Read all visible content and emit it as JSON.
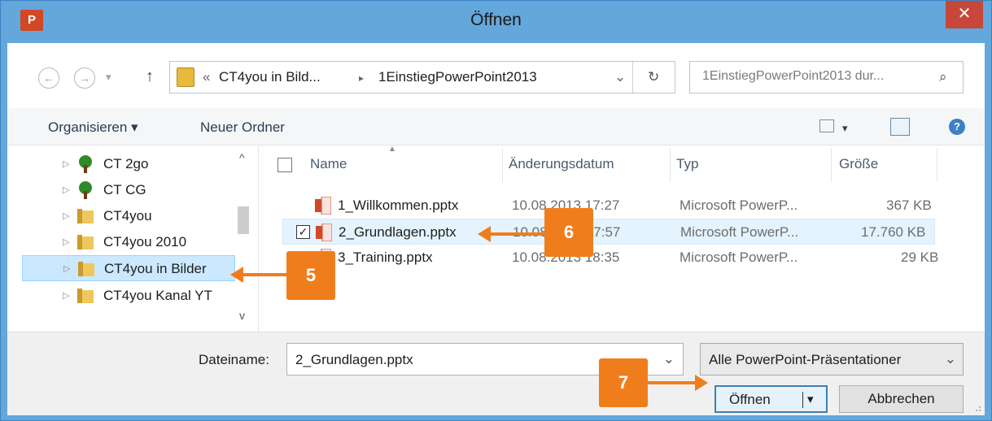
{
  "window": {
    "title": "Öffnen",
    "app_icon_label": "P",
    "close_glyph": "✕"
  },
  "address_bar": {
    "back_glyph": "←",
    "forward_glyph": "→",
    "recent_glyph": "▾",
    "up_glyph": "↑",
    "overflow": "«",
    "crumbs": [
      "CT4you in Bild...",
      "1EinstiegPowerPoint2013"
    ],
    "separator": "▸",
    "dropdown_glyph": "⌄",
    "refresh_glyph": "↻",
    "search_placeholder": "1EinstiegPowerPoint2013 dur...",
    "search_glyph": "⌕"
  },
  "toolbar": {
    "organize_label": "Organisieren ▾",
    "new_folder_label": "Neuer Ordner",
    "view_glyph": "▾",
    "help_glyph": "?"
  },
  "tree": {
    "items": [
      {
        "label": "CT 2go",
        "icon": "tree-icon"
      },
      {
        "label": "CT CG",
        "icon": "tree-icon"
      },
      {
        "label": "CT4you",
        "icon": "folder-icon"
      },
      {
        "label": "CT4you 2010",
        "icon": "folder-icon"
      },
      {
        "label": "CT4you in Bilder",
        "icon": "folder-icon"
      },
      {
        "label": "CT4you Kanal YT",
        "icon": "folder-icon"
      }
    ],
    "expand_glyph": "▷",
    "scroll_up": "^",
    "scroll_down": "v"
  },
  "file_list": {
    "columns": [
      "Name",
      "Änderungsdatum",
      "Typ",
      "Größe"
    ],
    "sort_glyph": "▲",
    "rows": [
      {
        "name": "1_Willkommen.pptx",
        "date": "10.08.2013 17:27",
        "type": "Microsoft PowerP...",
        "size": "367 KB",
        "checked": false
      },
      {
        "name": "2_Grundlagen.pptx",
        "date": "10.08.2013 17:57",
        "type": "Microsoft PowerP...",
        "size": "17.760 KB",
        "checked": true
      },
      {
        "name": "3_Training.pptx",
        "date": "10.08.2013 18:35",
        "type": "Microsoft PowerP...",
        "size": "29 KB",
        "checked": false
      }
    ],
    "check_glyph": "✓"
  },
  "footer": {
    "filename_label": "Dateiname:",
    "filename_value": "2_Grundlagen.pptx",
    "filter_value": "Alle PowerPoint-Präsentationer",
    "open_label": "Öffnen",
    "open_split_glyph": "▾",
    "cancel_label": "Abbrechen"
  },
  "annotations": {
    "step5": "5",
    "step6": "6",
    "step7": "7",
    "color": "#f07d1c"
  }
}
